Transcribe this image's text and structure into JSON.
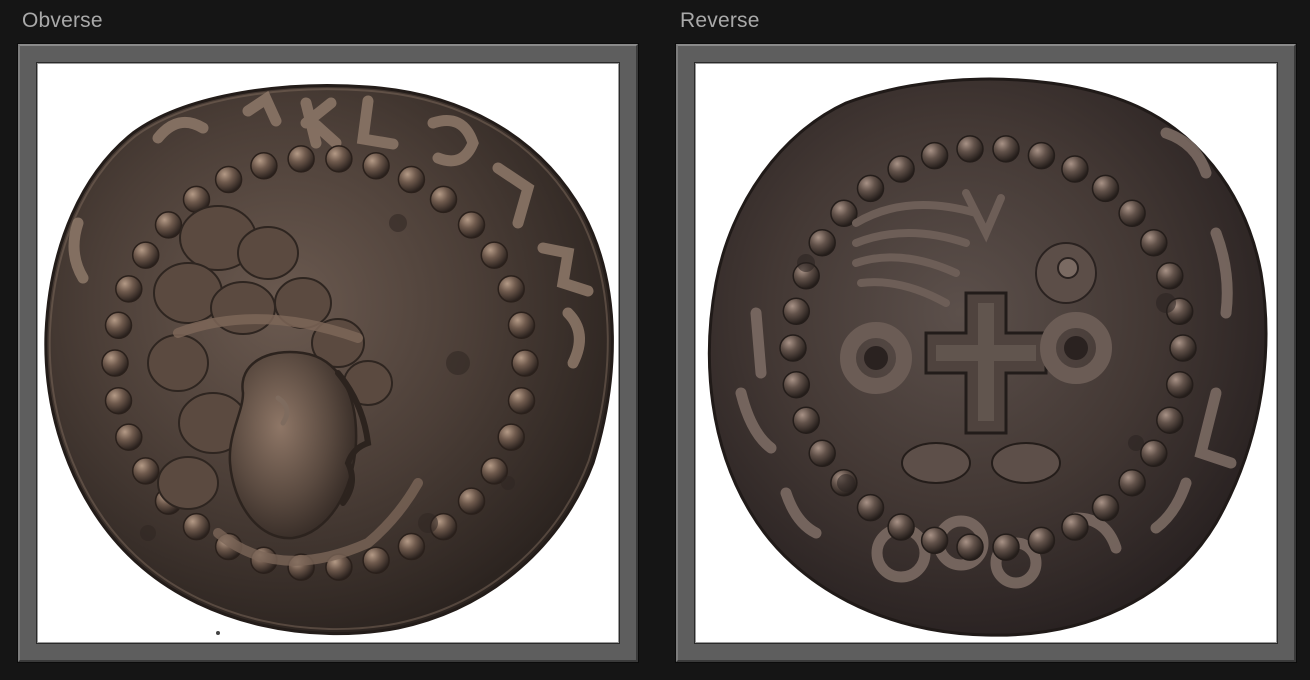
{
  "panels": [
    {
      "label": "Obverse",
      "image_subject": "coin-obverse-bust"
    },
    {
      "label": "Reverse",
      "image_subject": "coin-reverse-cross"
    }
  ],
  "colors": {
    "page_background": "#151515",
    "label_text": "#a9a9a9",
    "frame": "#5e5e5e",
    "image_background": "#ffffff",
    "coin_metal": "#4a3d36"
  }
}
